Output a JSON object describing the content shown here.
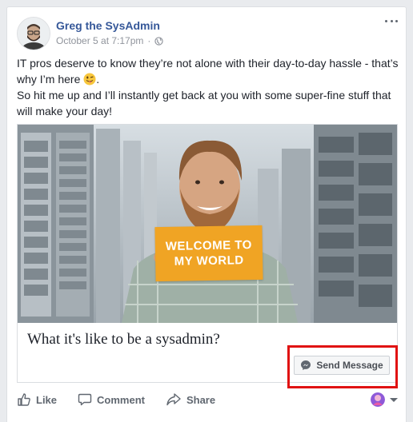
{
  "post": {
    "author": "Greg the SysAdmin",
    "timestamp": "October 5 at 7:17pm",
    "separator": "·",
    "privacy_icon": "globe-icon",
    "text_line1": "IT pros deserve to know they’re not alone with their day-to-day hassle - that’s why I’m here",
    "text_emoji": "winking-face-with-tongue",
    "text_line1_end": ".",
    "text_line2": "So hit me up and I’ll instantly get back at you with some super-fine stuff that will make your day!"
  },
  "link_card": {
    "image_sign_text": "WELCOME TO MY WORLD",
    "title": "What it's like to be a sysadmin?",
    "cta_label": "Send Message",
    "cta_icon": "messenger-icon"
  },
  "actions": {
    "like": "Like",
    "comment": "Comment",
    "share": "Share"
  },
  "colors": {
    "author": "#365899",
    "highlight": "#e01212",
    "sign": "#f0a424"
  }
}
